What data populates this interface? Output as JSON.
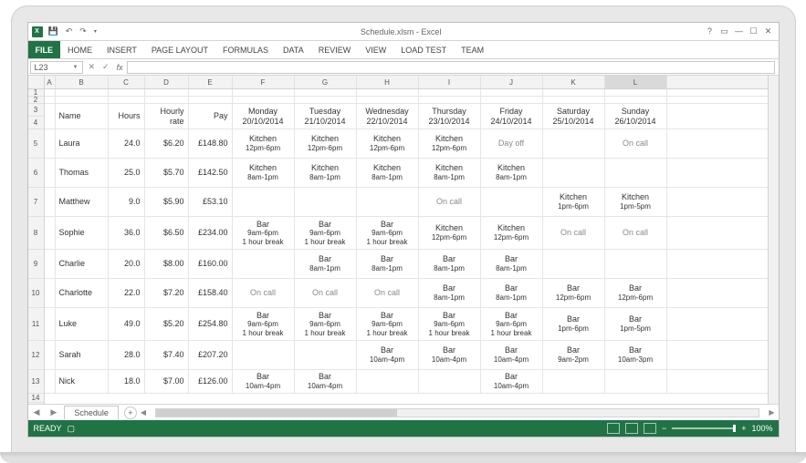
{
  "title": "Schedule.xlsm - Excel",
  "namebox": "L23",
  "tabs": {
    "file": "FILE",
    "home": "HOME",
    "insert": "INSERT",
    "pagelayout": "PAGE LAYOUT",
    "formulas": "FORMULAS",
    "data": "DATA",
    "review": "REVIEW",
    "view": "VIEW",
    "loadtest": "LOAD TEST",
    "team": "TEAM"
  },
  "columns": [
    "A",
    "B",
    "C",
    "D",
    "E",
    "F",
    "G",
    "H",
    "I",
    "J",
    "K",
    "L"
  ],
  "row_numbers": [
    "1",
    "2",
    "3",
    "4",
    "5",
    "6",
    "7",
    "8",
    "9",
    "10",
    "11",
    "12",
    "13",
    "14"
  ],
  "headers": {
    "name": "Name",
    "hours": "Hours",
    "rate": "Hourly rate",
    "pay": "Pay",
    "days": [
      {
        "dow": "Monday",
        "date": "20/10/2014"
      },
      {
        "dow": "Tuesday",
        "date": "21/10/2014"
      },
      {
        "dow": "Wednesday",
        "date": "22/10/2014"
      },
      {
        "dow": "Thursday",
        "date": "23/10/2014"
      },
      {
        "dow": "Friday",
        "date": "24/10/2014"
      },
      {
        "dow": "Saturday",
        "date": "25/10/2014"
      },
      {
        "dow": "Sunday",
        "date": "26/10/2014"
      }
    ]
  },
  "rows": [
    {
      "name": "Laura",
      "hours": "24.0",
      "rate": "$6.20",
      "pay": "£148.80",
      "shifts": [
        {
          "l1": "Kitchen",
          "l2": "12pm-6pm"
        },
        {
          "l1": "Kitchen",
          "l2": "12pm-6pm"
        },
        {
          "l1": "Kitchen",
          "l2": "12pm-6pm"
        },
        {
          "l1": "Kitchen",
          "l2": "12pm-6pm"
        },
        {
          "l1": "Day off",
          "muted": true
        },
        {
          "l1": ""
        },
        {
          "l1": "On call",
          "muted": true
        }
      ]
    },
    {
      "name": "Thomas",
      "hours": "25.0",
      "rate": "$5.70",
      "pay": "£142.50",
      "shifts": [
        {
          "l1": "Kitchen",
          "l2": "8am-1pm"
        },
        {
          "l1": "Kitchen",
          "l2": "8am-1pm"
        },
        {
          "l1": "Kitchen",
          "l2": "8am-1pm"
        },
        {
          "l1": "Kitchen",
          "l2": "8am-1pm"
        },
        {
          "l1": "Kitchen",
          "l2": "8am-1pm"
        },
        {
          "l1": ""
        },
        {
          "l1": ""
        }
      ]
    },
    {
      "name": "Matthew",
      "hours": "9.0",
      "rate": "$5.90",
      "pay": "£53.10",
      "shifts": [
        {
          "l1": ""
        },
        {
          "l1": ""
        },
        {
          "l1": ""
        },
        {
          "l1": "On call",
          "muted": true
        },
        {
          "l1": ""
        },
        {
          "l1": "Kitchen",
          "l2": "1pm-6pm"
        },
        {
          "l1": "Kitchen",
          "l2": "1pm-5pm"
        }
      ]
    },
    {
      "name": "Sophie",
      "hours": "36.0",
      "rate": "$6.50",
      "pay": "£234.00",
      "shifts": [
        {
          "l1": "Bar",
          "l2": "9am-6pm",
          "l3": "1 hour break"
        },
        {
          "l1": "Bar",
          "l2": "9am-6pm",
          "l3": "1 hour break"
        },
        {
          "l1": "Bar",
          "l2": "9am-6pm",
          "l3": "1 hour break"
        },
        {
          "l1": "Kitchen",
          "l2": "12pm-6pm"
        },
        {
          "l1": "Kitchen",
          "l2": "12pm-6pm"
        },
        {
          "l1": "On call",
          "muted": true
        },
        {
          "l1": "On call",
          "muted": true
        }
      ]
    },
    {
      "name": "Charlie",
      "hours": "20.0",
      "rate": "$8.00",
      "pay": "£160.00",
      "shifts": [
        {
          "l1": ""
        },
        {
          "l1": "Bar",
          "l2": "8am-1pm"
        },
        {
          "l1": "Bar",
          "l2": "8am-1pm"
        },
        {
          "l1": "Bar",
          "l2": "8am-1pm"
        },
        {
          "l1": "Bar",
          "l2": "8am-1pm"
        },
        {
          "l1": ""
        },
        {
          "l1": ""
        }
      ]
    },
    {
      "name": "Charlotte",
      "hours": "22.0",
      "rate": "$7.20",
      "pay": "£158.40",
      "shifts": [
        {
          "l1": "On call",
          "muted": true
        },
        {
          "l1": "On call",
          "muted": true
        },
        {
          "l1": "On call",
          "muted": true
        },
        {
          "l1": "Bar",
          "l2": "8am-1pm"
        },
        {
          "l1": "Bar",
          "l2": "8am-1pm"
        },
        {
          "l1": "Bar",
          "l2": "12pm-6pm"
        },
        {
          "l1": "Bar",
          "l2": "12pm-6pm"
        }
      ]
    },
    {
      "name": "Luke",
      "hours": "49.0",
      "rate": "$5.20",
      "pay": "£254.80",
      "shifts": [
        {
          "l1": "Bar",
          "l2": "9am-6pm",
          "l3": "1 hour break"
        },
        {
          "l1": "Bar",
          "l2": "9am-6pm",
          "l3": "1 hour break"
        },
        {
          "l1": "Bar",
          "l2": "9am-6pm",
          "l3": "1 hour break"
        },
        {
          "l1": "Bar",
          "l2": "9am-6pm",
          "l3": "1 hour break"
        },
        {
          "l1": "Bar",
          "l2": "9am-6pm",
          "l3": "1 hour break"
        },
        {
          "l1": "Bar",
          "l2": "1pm-6pm"
        },
        {
          "l1": "Bar",
          "l2": "1pm-5pm"
        }
      ]
    },
    {
      "name": "Sarah",
      "hours": "28.0",
      "rate": "$7.40",
      "pay": "£207.20",
      "shifts": [
        {
          "l1": ""
        },
        {
          "l1": ""
        },
        {
          "l1": "Bar",
          "l2": "10am-4pm"
        },
        {
          "l1": "Bar",
          "l2": "10am-4pm"
        },
        {
          "l1": "Bar",
          "l2": "10am-4pm"
        },
        {
          "l1": "Bar",
          "l2": "9am-2pm"
        },
        {
          "l1": "Bar",
          "l2": "10am-3pm"
        }
      ]
    },
    {
      "name": "Nick",
      "hours": "18.0",
      "rate": "$7.00",
      "pay": "£126.00",
      "shifts": [
        {
          "l1": "Bar",
          "l2": "10am-4pm"
        },
        {
          "l1": "Bar",
          "l2": "10am-4pm"
        },
        {
          "l1": ""
        },
        {
          "l1": ""
        },
        {
          "l1": "Bar",
          "l2": "10am-4pm"
        },
        {
          "l1": ""
        },
        {
          "l1": ""
        }
      ]
    }
  ],
  "sheet_tab": "Schedule",
  "status": {
    "ready": "READY",
    "zoom": "100%"
  }
}
